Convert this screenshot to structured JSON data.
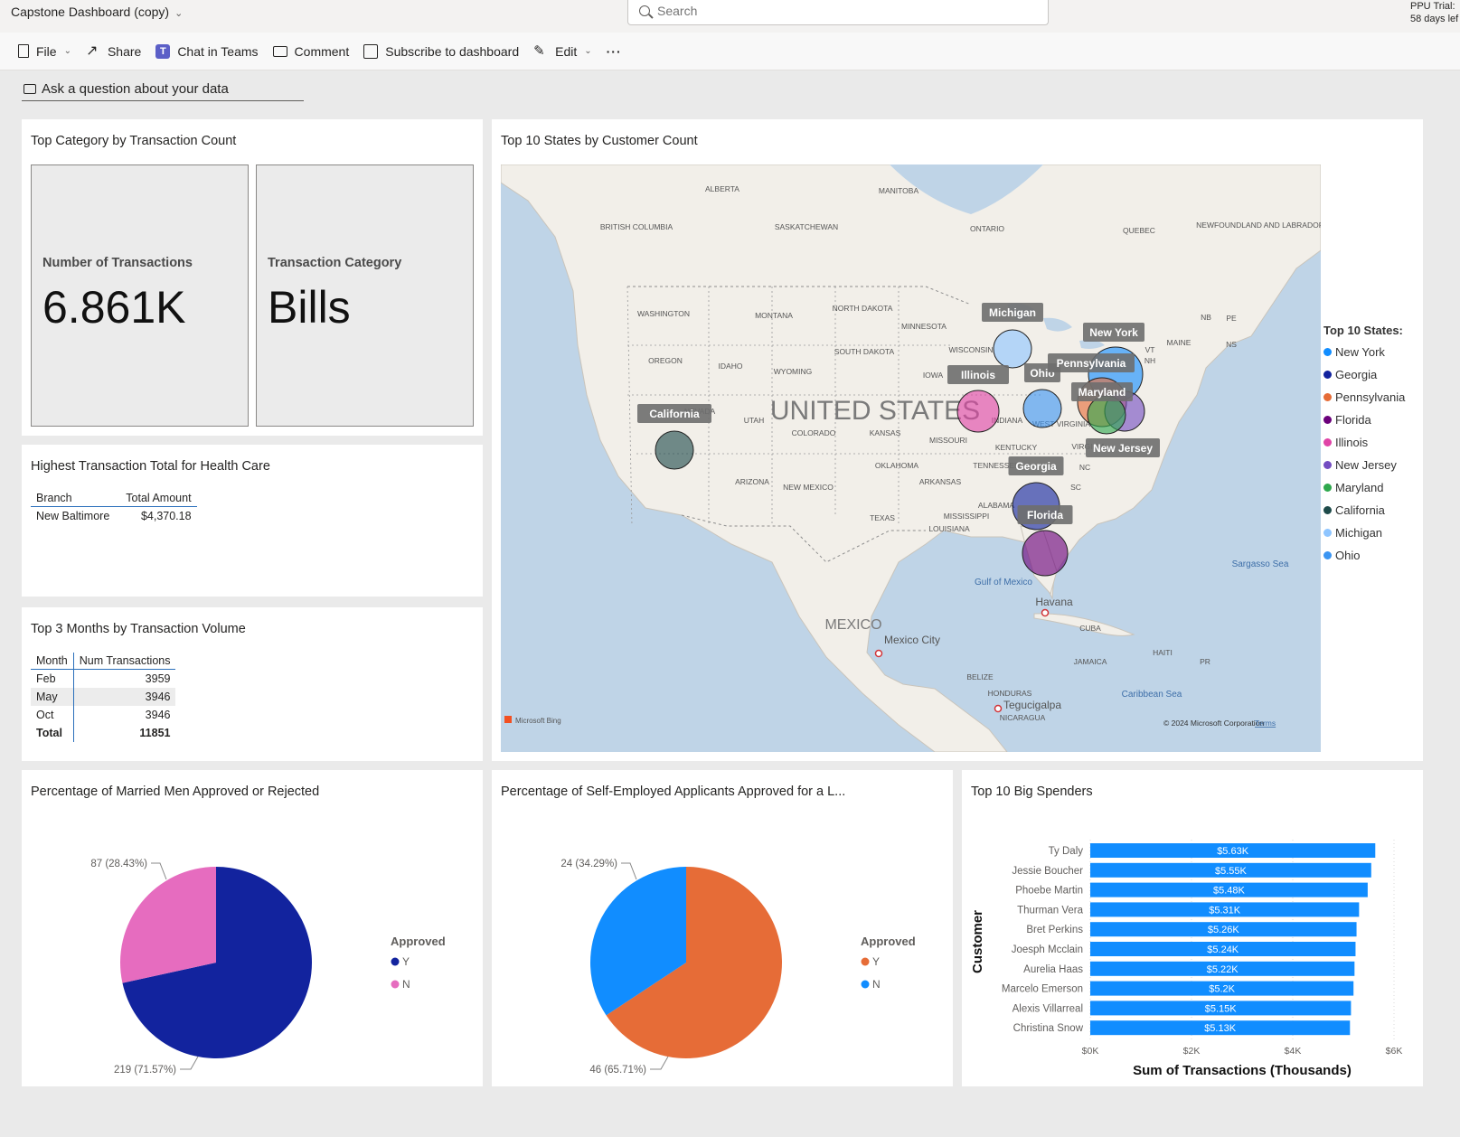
{
  "app": {
    "title": "Capstone Dashboard (copy)",
    "search_placeholder": "Search",
    "trial_line1": "PPU Trial:",
    "trial_line2": "58 days lef"
  },
  "toolbar": {
    "file": "File",
    "share": "Share",
    "chat": "Chat in Teams",
    "comment": "Comment",
    "subscribe": "Subscribe to dashboard",
    "edit": "Edit",
    "more": "···"
  },
  "ask": {
    "label": "Ask a question about your data"
  },
  "tiles": {
    "top_category": {
      "title": "Top Category by Transaction Count",
      "card1_label": "Number of Transactions",
      "card1_value": "6.861K",
      "card2_label": "Transaction Category",
      "card2_value": "Bills"
    },
    "health_care": {
      "title": "Highest Transaction Total for Health Care",
      "headers": [
        "Branch",
        "Total Amount"
      ],
      "row": [
        "New Baltimore",
        "$4,370.18"
      ]
    },
    "top_months": {
      "title": "Top 3 Months by Transaction Volume",
      "headers": [
        "Month",
        "Num Transactions"
      ],
      "rows": [
        [
          "Feb",
          "3959"
        ],
        [
          "May",
          "3946"
        ],
        [
          "Oct",
          "3946"
        ]
      ],
      "total": [
        "Total",
        "11851"
      ]
    },
    "map": {
      "title": "Top 10 States by Customer Count",
      "legend_title": "Top 10 States:",
      "states": [
        {
          "name": "New York",
          "color": "#118dff"
        },
        {
          "name": "Georgia",
          "color": "#12239e"
        },
        {
          "name": "Pennsylvania",
          "color": "#e66c37"
        },
        {
          "name": "Florida",
          "color": "#6b007b"
        },
        {
          "name": "Illinois",
          "color": "#e044a7"
        },
        {
          "name": "New Jersey",
          "color": "#744ec2"
        },
        {
          "name": "Maryland",
          "color": "#2ea84d"
        },
        {
          "name": "California",
          "color": "#1e4b4a"
        },
        {
          "name": "Michigan",
          "color": "#8ec5ff"
        },
        {
          "name": "Ohio",
          "color": "#3b95f2"
        }
      ],
      "country_label": "UNITED STATES",
      "mexico_label": "MEXICO",
      "places": [
        "ALBERTA",
        "MANITOBA",
        "BRITISH COLUMBIA",
        "SASKATCHEWAN",
        "ONTARIO",
        "QUEBEC",
        "NEWFOUNDLAND AND LABRADOR",
        "WASHINGTON",
        "MONTANA",
        "NORTH DAKOTA",
        "MINNESOTA",
        "OREGON",
        "IDAHO",
        "SOUTH DAKOTA",
        "WYOMING",
        "WISCONSIN",
        "IOWA",
        "NEVADA",
        "UTAH",
        "COLORADO",
        "KANSAS",
        "MISSOURI",
        "INDIANA",
        "KENTUCKY",
        "VIRGINIA",
        "WEST VIRGINIA",
        "ARIZONA",
        "NEW MEXICO",
        "OKLAHOMA",
        "ARKANSAS",
        "TENNESSEE",
        "TEXAS",
        "MISSISSIPPI",
        "LOUISIANA",
        "ALABAMA",
        "SC",
        "NC",
        "MAINE",
        "NB",
        "NS",
        "PE",
        "VT",
        "NH",
        "Gulf of Mexico",
        "Sargasso Sea",
        "Havana",
        "CUBA",
        "HAITI",
        "JAMAICA",
        "PR",
        "BELIZE",
        "HONDURAS",
        "NICARAGUA",
        "Tegucigalpa",
        "Mexico City",
        "Caribbean Sea"
      ],
      "attribution": "© 2024 Microsoft Corporation",
      "terms": "Terms",
      "bing": "Microsoft Bing"
    },
    "married_men": {
      "title": "Percentage of Married Men Approved or Rejected",
      "legend_title": "Approved",
      "legend": [
        "Y",
        "N"
      ],
      "label_y": "219 (71.57%)",
      "label_n": "87 (28.43%)",
      "colors": {
        "Y": "#12239e",
        "N": "#e66cbf"
      }
    },
    "self_employed": {
      "title": "Percentage of Self-Employed Applicants Approved for a L...",
      "legend_title": "Approved",
      "legend": [
        "Y",
        "N"
      ],
      "label_y": "46 (65.71%)",
      "label_n": "24 (34.29%)",
      "colors": {
        "Y": "#e66c37",
        "N": "#118dff"
      }
    },
    "big_spenders": {
      "title": "Top 10 Big Spenders"
    }
  },
  "chart_data": [
    {
      "type": "pie",
      "title": "Percentage of Married Men Approved or Rejected",
      "categories": [
        "Y",
        "N"
      ],
      "values": [
        219,
        87
      ],
      "percent": [
        71.57,
        28.43
      ]
    },
    {
      "type": "pie",
      "title": "Percentage of Self-Employed Applicants Approved for a L...",
      "categories": [
        "Y",
        "N"
      ],
      "values": [
        46,
        24
      ],
      "percent": [
        65.71,
        34.29
      ]
    },
    {
      "type": "bar",
      "orientation": "horizontal",
      "title": "Top 10 Big Spenders",
      "categories": [
        "Ty Daly",
        "Jessie Boucher",
        "Phoebe Martin",
        "Thurman Vera",
        "Bret Perkins",
        "Joesph Mcclain",
        "Aurelia Haas",
        "Marcelo Emerson",
        "Alexis Villarreal",
        "Christina Snow"
      ],
      "values": [
        5.63,
        5.55,
        5.48,
        5.31,
        5.26,
        5.24,
        5.22,
        5.2,
        5.15,
        5.13
      ],
      "data_labels": [
        "$5.63K",
        "$5.55K",
        "$5.48K",
        "$5.31K",
        "$5.26K",
        "$5.24K",
        "$5.22K",
        "$5.2K",
        "$5.15K",
        "$5.13K"
      ],
      "xlabel": "Sum of Transactions (Thousands)",
      "ylabel": "Customer",
      "xlim": [
        0,
        6
      ],
      "xticks": [
        "$0K",
        "$2K",
        "$4K",
        "$6K"
      ],
      "color": "#118dff"
    }
  ]
}
